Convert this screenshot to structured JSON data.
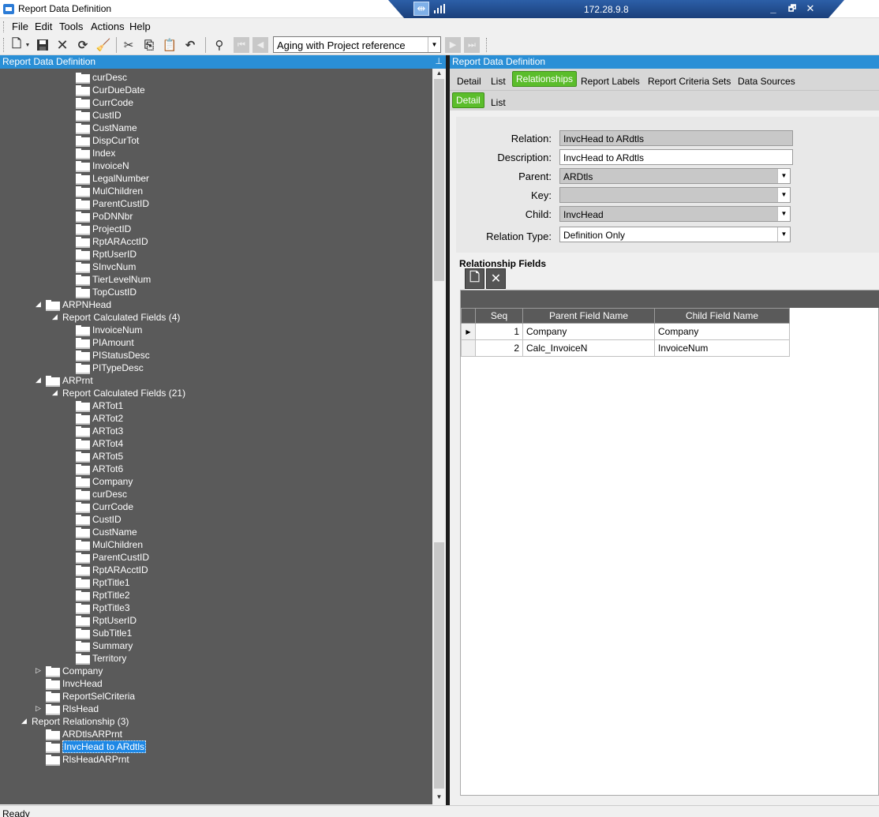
{
  "window": {
    "title": "Report Data Definition"
  },
  "rdp": {
    "ip": "172.28.9.8",
    "minimize": "_",
    "restore": "🗗",
    "close": "✕"
  },
  "menu": [
    "File",
    "Edit",
    "Tools",
    "Actions",
    "Help"
  ],
  "toolbar": {
    "search_value": "Aging with Project reference"
  },
  "left_panel": {
    "header": "Report Data Definition",
    "tree": [
      {
        "label": "curDesc",
        "indent": 3,
        "type": "field"
      },
      {
        "label": "CurDueDate",
        "indent": 3,
        "type": "field"
      },
      {
        "label": "CurrCode",
        "indent": 3,
        "type": "field"
      },
      {
        "label": "CustID",
        "indent": 3,
        "type": "field"
      },
      {
        "label": "CustName",
        "indent": 3,
        "type": "field"
      },
      {
        "label": "DispCurTot",
        "indent": 3,
        "type": "field"
      },
      {
        "label": "Index",
        "indent": 3,
        "type": "field"
      },
      {
        "label": "InvoiceN",
        "indent": 3,
        "type": "field"
      },
      {
        "label": "LegalNumber",
        "indent": 3,
        "type": "field"
      },
      {
        "label": "MulChildren",
        "indent": 3,
        "type": "field"
      },
      {
        "label": "ParentCustID",
        "indent": 3,
        "type": "field"
      },
      {
        "label": "PoDNNbr",
        "indent": 3,
        "type": "field"
      },
      {
        "label": "ProjectID",
        "indent": 3,
        "type": "field"
      },
      {
        "label": "RptARAcctID",
        "indent": 3,
        "type": "field"
      },
      {
        "label": "RptUserID",
        "indent": 3,
        "type": "field"
      },
      {
        "label": "SInvcNum",
        "indent": 3,
        "type": "field"
      },
      {
        "label": "TierLevelNum",
        "indent": 3,
        "type": "field"
      },
      {
        "label": "TopCustID",
        "indent": 3,
        "type": "field"
      },
      {
        "label": "ARPNHead",
        "indent": 1,
        "type": "table",
        "expander": "open"
      },
      {
        "label": "Report Calculated Fields (4)",
        "indent": 2,
        "type": "group",
        "expander": "open"
      },
      {
        "label": "InvoiceNum",
        "indent": 3,
        "type": "field"
      },
      {
        "label": "PIAmount",
        "indent": 3,
        "type": "field"
      },
      {
        "label": "PIStatusDesc",
        "indent": 3,
        "type": "field"
      },
      {
        "label": "PITypeDesc",
        "indent": 3,
        "type": "field"
      },
      {
        "label": "ARPrnt",
        "indent": 1,
        "type": "table",
        "expander": "open"
      },
      {
        "label": "Report Calculated Fields (21)",
        "indent": 2,
        "type": "group",
        "expander": "open"
      },
      {
        "label": "ARTot1",
        "indent": 3,
        "type": "field"
      },
      {
        "label": "ARTot2",
        "indent": 3,
        "type": "field"
      },
      {
        "label": "ARTot3",
        "indent": 3,
        "type": "field"
      },
      {
        "label": "ARTot4",
        "indent": 3,
        "type": "field"
      },
      {
        "label": "ARTot5",
        "indent": 3,
        "type": "field"
      },
      {
        "label": "ARTot6",
        "indent": 3,
        "type": "field"
      },
      {
        "label": "Company",
        "indent": 3,
        "type": "field"
      },
      {
        "label": "curDesc",
        "indent": 3,
        "type": "field"
      },
      {
        "label": "CurrCode",
        "indent": 3,
        "type": "field"
      },
      {
        "label": "CustID",
        "indent": 3,
        "type": "field"
      },
      {
        "label": "CustName",
        "indent": 3,
        "type": "field"
      },
      {
        "label": "MulChildren",
        "indent": 3,
        "type": "field"
      },
      {
        "label": "ParentCustID",
        "indent": 3,
        "type": "field"
      },
      {
        "label": "RptARAcctID",
        "indent": 3,
        "type": "field"
      },
      {
        "label": "RptTitle1",
        "indent": 3,
        "type": "field"
      },
      {
        "label": "RptTitle2",
        "indent": 3,
        "type": "field"
      },
      {
        "label": "RptTitle3",
        "indent": 3,
        "type": "field"
      },
      {
        "label": "RptUserID",
        "indent": 3,
        "type": "field"
      },
      {
        "label": "SubTitle1",
        "indent": 3,
        "type": "field"
      },
      {
        "label": "Summary",
        "indent": 3,
        "type": "field"
      },
      {
        "label": "Territory",
        "indent": 3,
        "type": "field"
      },
      {
        "label": "Company",
        "indent": 1,
        "type": "table",
        "expander": "closed"
      },
      {
        "label": "InvcHead",
        "indent": 1,
        "type": "table"
      },
      {
        "label": "ReportSelCriteria",
        "indent": 1,
        "type": "table"
      },
      {
        "label": "RlsHead",
        "indent": 1,
        "type": "table",
        "expander": "closed"
      },
      {
        "label": "Report Relationship (3)",
        "indent": 0,
        "type": "group",
        "expander": "open"
      },
      {
        "label": "ARDtlsARPrnt",
        "indent": 1,
        "type": "table"
      },
      {
        "label": "InvcHead to ARdtls",
        "indent": 1,
        "type": "table",
        "selected": true
      },
      {
        "label": "RlsHeadARPrnt",
        "indent": 1,
        "type": "table"
      }
    ]
  },
  "right_panel": {
    "header": "Report Data Definition",
    "tabs": [
      "Detail",
      "List",
      "Relationships",
      "Report Labels",
      "Report Criteria Sets",
      "Data Sources"
    ],
    "active_tab": "Relationships",
    "subtabs": [
      "Detail",
      "List"
    ],
    "active_subtab": "Detail",
    "form": {
      "relation_label": "Relation:",
      "relation_value": "InvcHead to ARdtls",
      "description_label": "Description:",
      "description_value": "InvcHead to ARdtls",
      "parent_label": "Parent:",
      "parent_value": "ARDtls",
      "key_label": "Key:",
      "key_value": "",
      "child_label": "Child:",
      "child_value": "InvcHead",
      "relation_type_label": "Relation Type:",
      "relation_type_value": "Definition Only"
    },
    "relationship_fields": {
      "title": "Relationship Fields",
      "columns": [
        "Seq",
        "Parent Field Name",
        "Child Field Name"
      ],
      "rows": [
        {
          "seq": "1",
          "parent": "Company",
          "child": "Company"
        },
        {
          "seq": "2",
          "parent": "Calc_InvoiceN",
          "child": "InvoiceNum"
        }
      ]
    }
  },
  "status": {
    "text": "Ready"
  },
  "colors": {
    "header_blue": "#2a8fd6",
    "tab_green": "#5bbd2b",
    "tree_bg": "#5a5a5a"
  }
}
